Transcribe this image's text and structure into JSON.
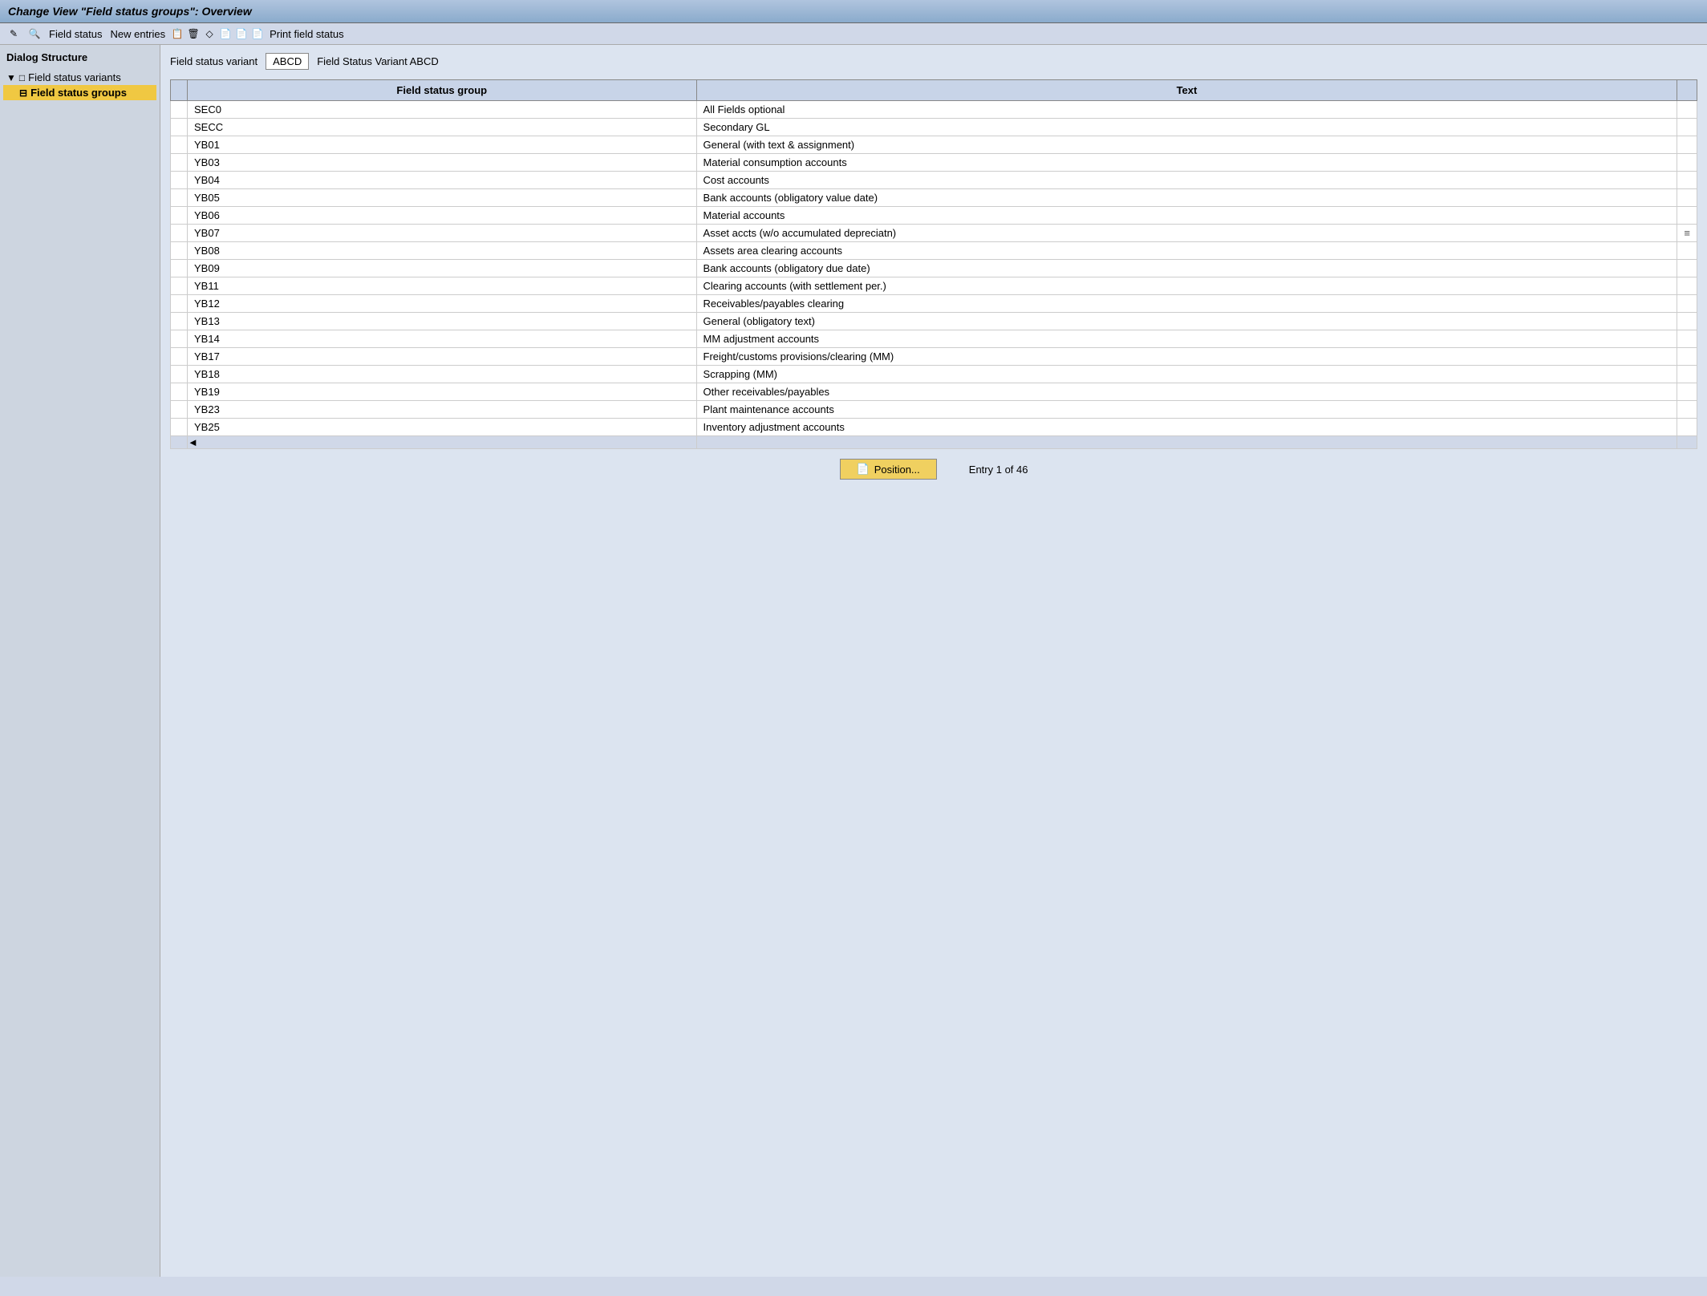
{
  "title": "Change View \"Field status groups\": Overview",
  "toolbar": {
    "items": [
      {
        "label": "",
        "icon": "✎",
        "name": "edit-icon"
      },
      {
        "label": "",
        "icon": "🔍",
        "name": "search-icon"
      },
      {
        "label": "Field status",
        "name": "field-status-label"
      },
      {
        "label": "New entries",
        "name": "new-entries-label"
      },
      {
        "label": "",
        "icon": "📋",
        "name": "copy-icon"
      },
      {
        "label": "",
        "icon": "🗑",
        "name": "delete-icon"
      },
      {
        "label": "",
        "icon": "◇",
        "name": "diamond-icon"
      },
      {
        "label": "",
        "icon": "📄",
        "name": "doc1-icon"
      },
      {
        "label": "",
        "icon": "📄",
        "name": "doc2-icon"
      },
      {
        "label": "",
        "icon": "📄",
        "name": "doc3-icon"
      },
      {
        "label": "Print field status",
        "name": "print-label"
      }
    ]
  },
  "sidebar": {
    "title": "Dialog Structure",
    "items": [
      {
        "label": "Field status variants",
        "indent": true,
        "active": false,
        "icon": "□",
        "arrow": "▼"
      },
      {
        "label": "Field status groups",
        "indent": true,
        "active": true,
        "icon": "⊟"
      }
    ]
  },
  "variant": {
    "label": "Field status variant",
    "value": "ABCD",
    "description": "Field Status Variant ABCD"
  },
  "table": {
    "columns": [
      "Field status group",
      "Text"
    ],
    "rows": [
      {
        "group": "SEC0",
        "text": "All Fields optional",
        "dashed": false
      },
      {
        "group": "SECC",
        "text": "Secondary GL",
        "dashed": false
      },
      {
        "group": "YB01",
        "text": "General (with text & assignment)",
        "dashed": false
      },
      {
        "group": "YB03",
        "text": "Material consumption accounts",
        "dashed": false
      },
      {
        "group": "YB04",
        "text": "Cost accounts",
        "dashed": false
      },
      {
        "group": "YB05",
        "text": "Bank accounts (obligatory value date)",
        "dashed": true
      },
      {
        "group": "YB06",
        "text": "Material accounts",
        "dashed": false
      },
      {
        "group": "YB07",
        "text": "Asset accts (w/o accumulated depreciatn)",
        "dashed": false
      },
      {
        "group": "YB08",
        "text": "Assets area clearing accounts",
        "dashed": false
      },
      {
        "group": "YB09",
        "text": "Bank accounts (obligatory due date)",
        "dashed": false
      },
      {
        "group": "YB11",
        "text": "Clearing accounts (with settlement per.)",
        "dashed": false
      },
      {
        "group": "YB12",
        "text": "Receivables/payables clearing",
        "dashed": false
      },
      {
        "group": "YB13",
        "text": "General (obligatory text)",
        "dashed": false
      },
      {
        "group": "YB14",
        "text": "MM adjustment accounts",
        "dashed": false
      },
      {
        "group": "YB17",
        "text": "Freight/customs provisions/clearing (MM)",
        "dashed": false
      },
      {
        "group": "YB18",
        "text": "Scrapping (MM)",
        "dashed": false
      },
      {
        "group": "YB19",
        "text": "Other receivables/payables",
        "dashed": false
      },
      {
        "group": "YB23",
        "text": "Plant maintenance accounts",
        "dashed": false
      },
      {
        "group": "YB25",
        "text": "Inventory adjustment accounts",
        "dashed": false
      }
    ]
  },
  "footer": {
    "position_button": "Position...",
    "entry_info": "Entry 1 of 46"
  }
}
